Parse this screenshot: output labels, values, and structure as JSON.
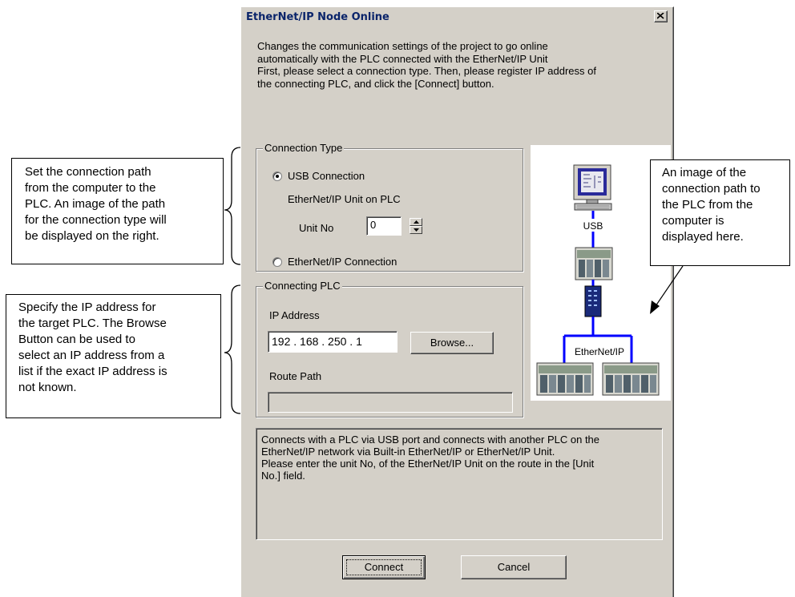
{
  "dialog": {
    "title": "EtherNet/IP Node Online",
    "intro_lines": [
      "Changes the communication settings of the project to go online",
      "automatically with the PLC connected with the EtherNet/IP Unit",
      "First, please select a connection type. Then, please register IP address of",
      "the connecting PLC, and click the [Connect] button."
    ],
    "connection_type": {
      "group_label": "Connection Type",
      "usb_option": "USB Connection",
      "unit_hint": "EtherNet/IP Unit on PLC",
      "unit_no_label": "Unit No",
      "unit_no_value": "0",
      "ethernet_option": "EtherNet/IP Connection",
      "selected": "usb"
    },
    "connecting_plc": {
      "group_label": "Connecting PLC",
      "ip_label": "IP Address",
      "ip_value": "192 . 168 . 250 .   1",
      "browse_label": "Browse...",
      "route_label": "Route Path",
      "route_value": ""
    },
    "description_lines": [
      "Connects with a PLC via USB port and connects with another PLC on the",
      "EtherNet/IP network via Built-in EtherNet/IP or EtherNet/IP Unit.",
      "Please enter the unit No, of the EtherNet/IP Unit on the route in the [Unit",
      "No.] field."
    ],
    "diagram": {
      "usb_label": "USB",
      "network_label": "EtherNet/IP"
    },
    "buttons": {
      "connect": "Connect",
      "cancel": "Cancel"
    }
  },
  "callouts": {
    "connection_path": [
      "Set the connection path",
      "from the computer to the",
      "PLC. An image of the path",
      "for the connection type will",
      "be displayed on the right."
    ],
    "ip_address": [
      "Specify the IP address for",
      "the target PLC. The Browse",
      "Button can be used to",
      "select an IP address from a",
      "list if the exact IP address is",
      "not known."
    ],
    "image_note": [
      "An image of the",
      "connection path to",
      "the PLC from the",
      "computer is",
      "displayed here."
    ]
  },
  "colors": {
    "dialog_face": "#d4d0c8",
    "title_text": "#0a246a",
    "network_line": "#0000ff"
  }
}
